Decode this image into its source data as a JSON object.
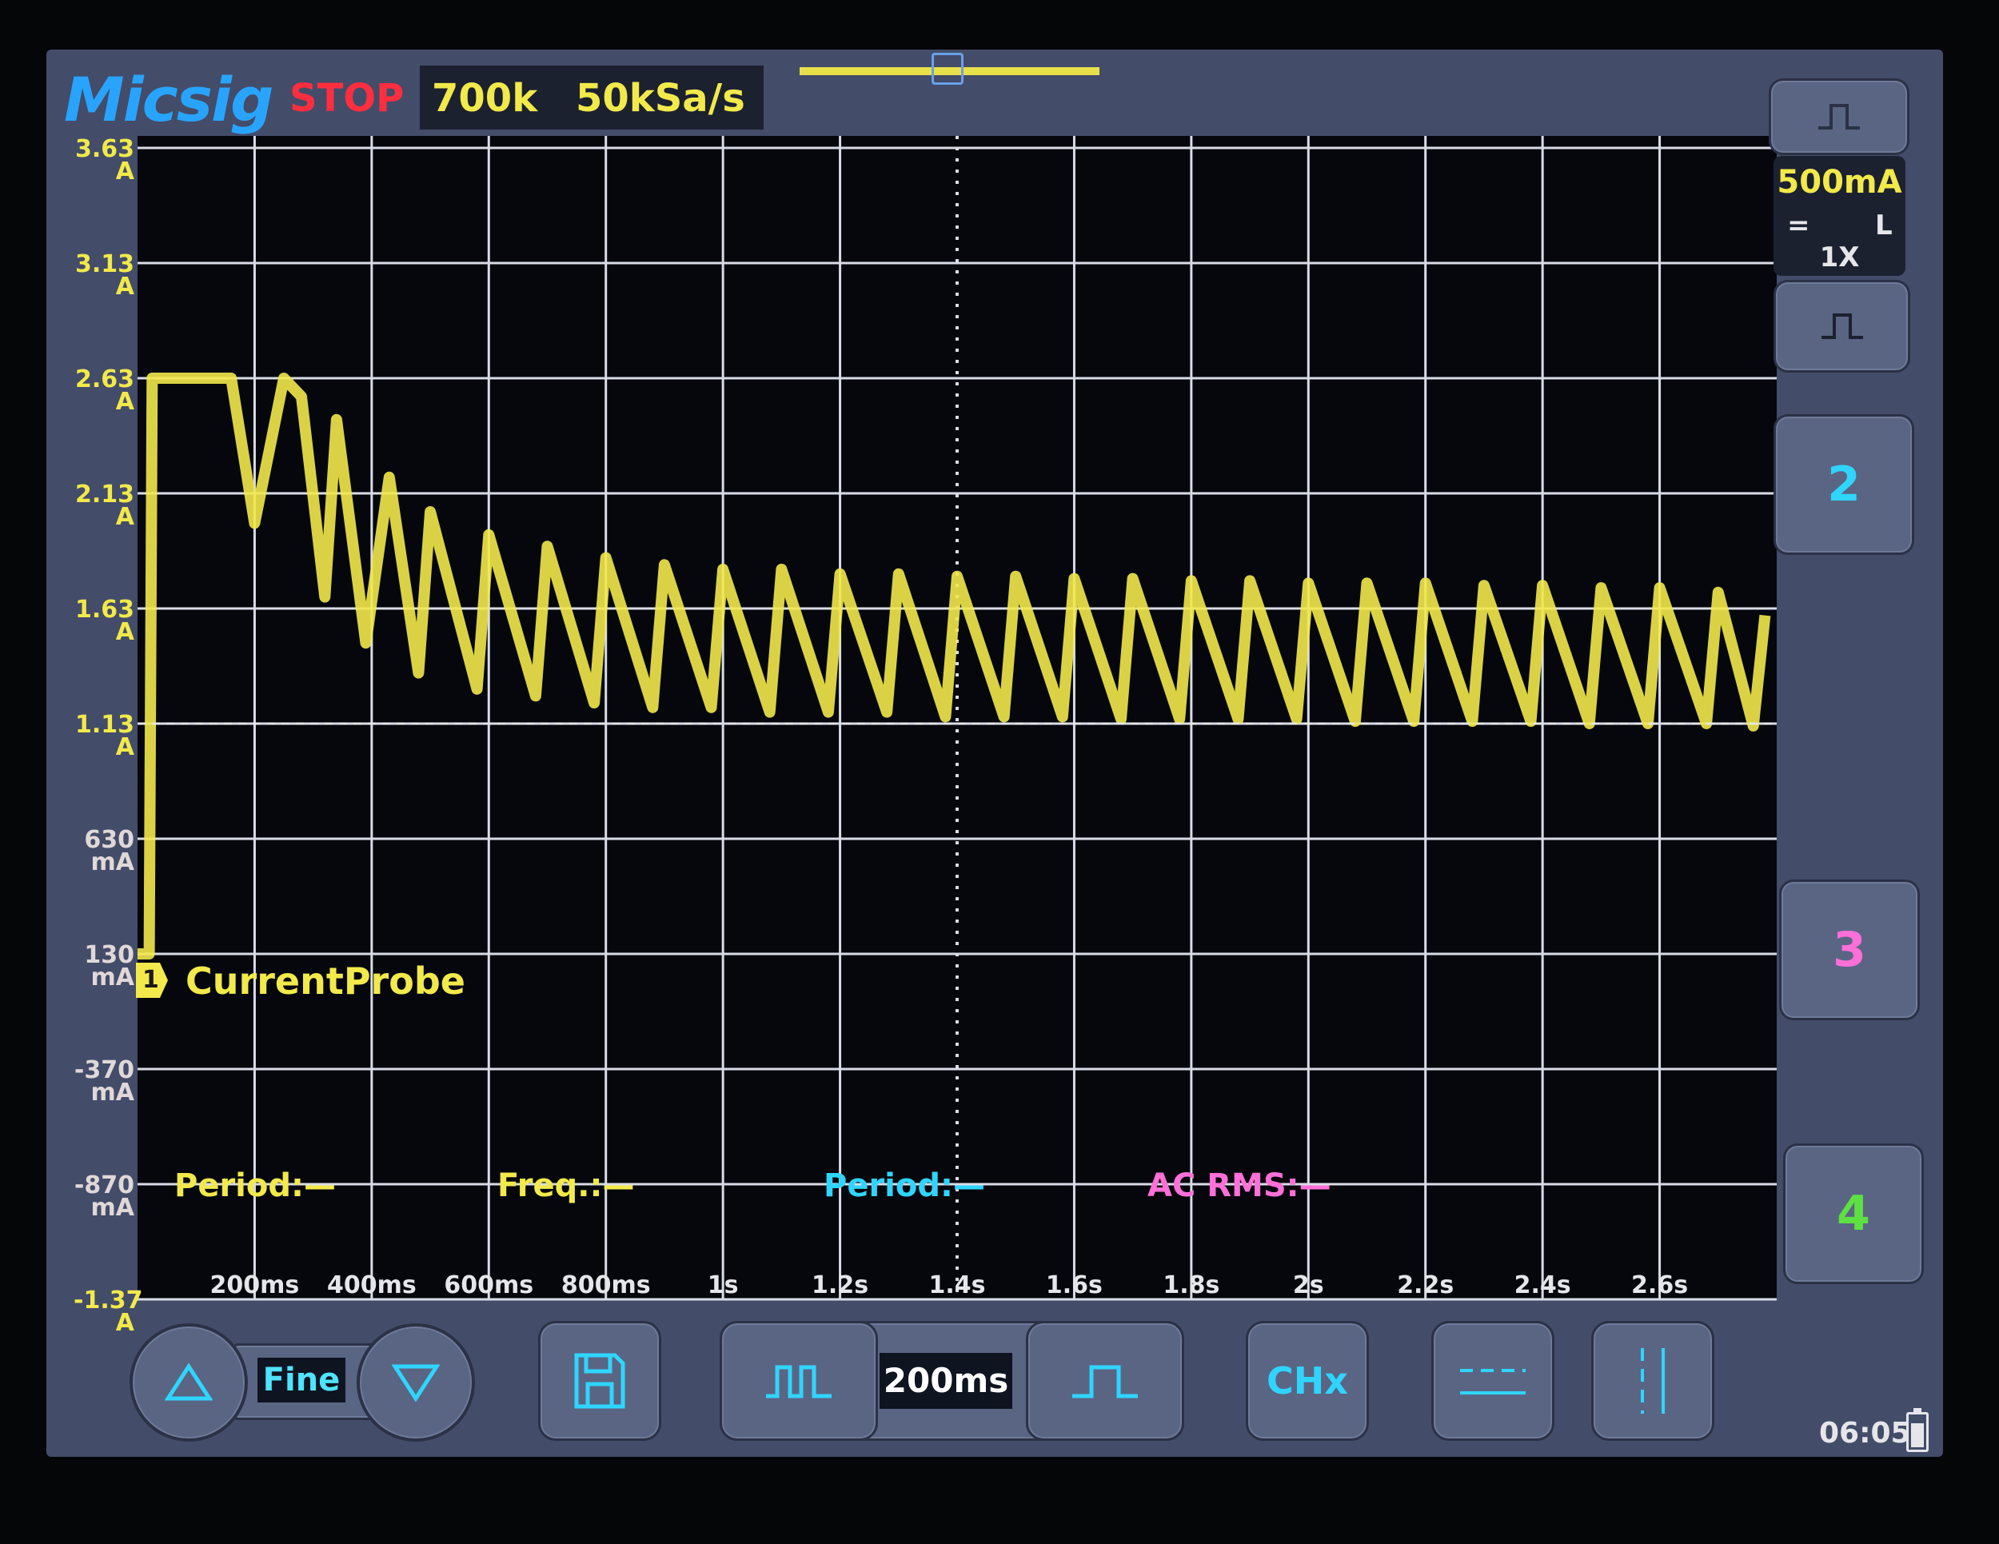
{
  "header": {
    "logo": "Micsig",
    "run_state": "STOP",
    "memory_depth": "700k",
    "sample_rate": "50kSa/s"
  },
  "colors": {
    "ch1": "#f2e94a",
    "ch2": "#2fd5ff",
    "ch3": "#ff6fd8",
    "ch4": "#5ee043",
    "stop": "#ff2e3e",
    "grid": "#d9dce6",
    "screen_bg": "#05070d"
  },
  "screen": {
    "y_labels": [
      {
        "value": "3.63",
        "unit": "A"
      },
      {
        "value": "3.13",
        "unit": "A"
      },
      {
        "value": "2.63",
        "unit": "A"
      },
      {
        "value": "2.13",
        "unit": "A"
      },
      {
        "value": "1.63",
        "unit": "A"
      },
      {
        "value": "1.13",
        "unit": "A"
      },
      {
        "value": "630",
        "unit": "mA"
      },
      {
        "value": "130",
        "unit": "mA"
      },
      {
        "value": "-370",
        "unit": "mA"
      },
      {
        "value": "-870",
        "unit": "mA"
      },
      {
        "value": "-1.37",
        "unit": "A"
      }
    ],
    "x_labels": [
      "200ms",
      "400ms",
      "600ms",
      "800ms",
      "1s",
      "1.2s",
      "1.4s",
      "1.6s",
      "1.8s",
      "2s",
      "2.2s",
      "2.4s",
      "2.6s"
    ],
    "probe_channel": "1",
    "probe_label": "CurrentProbe",
    "measurements": [
      {
        "label": "Period:—",
        "color": "#f2e94a"
      },
      {
        "label": "Freq.:—",
        "color": "#f2e94a"
      },
      {
        "label": "Period:—",
        "color": "#2fd5ff"
      },
      {
        "label": "AC RMS:—",
        "color": "#ff6fd8"
      }
    ]
  },
  "ch1": {
    "scale": "500mA",
    "coupling": "=",
    "bw": "L",
    "probe": "1X"
  },
  "channels": [
    {
      "label": "2",
      "color": "#2fd5ff"
    },
    {
      "label": "3",
      "color": "#ff6fd8"
    },
    {
      "label": "4",
      "color": "#5ee043"
    }
  ],
  "toolbar": {
    "adjust_mode": "Fine",
    "timebase": "200ms",
    "chx_label": "CHx"
  },
  "status": {
    "time": "06:05"
  },
  "icons": [
    "up-arrow-icon",
    "down-arrow-icon",
    "save-icon",
    "zoom-out-pulse-icon",
    "zoom-in-pulse-icon",
    "horizontal-cursor-icon",
    "vertical-cursor-icon",
    "battery-icon",
    "pulse-icon"
  ],
  "chart_data": {
    "type": "line",
    "xlabel": "",
    "ylabel": "",
    "xlim": [
      0,
      2.8
    ],
    "ylim": [
      -1.37,
      3.63
    ],
    "x_unit": "s",
    "y_unit": "A",
    "series": [
      {
        "x": [
          0.0,
          0.02,
          0.025,
          0.16,
          0.2,
          0.25,
          0.28,
          0.32,
          0.34,
          0.39,
          0.43,
          0.48,
          0.5,
          0.58,
          0.6,
          0.68,
          0.7,
          0.78,
          0.8,
          0.88,
          0.9,
          0.98,
          1.0,
          1.08,
          1.1,
          1.18,
          1.2,
          1.28,
          1.3,
          1.38,
          1.4,
          1.48,
          1.5,
          1.58,
          1.6,
          1.68,
          1.7,
          1.78,
          1.8,
          1.88,
          1.9,
          1.98,
          2.0,
          2.08,
          2.1,
          2.18,
          2.2,
          2.28,
          2.3,
          2.38,
          2.4,
          2.48,
          2.5,
          2.58,
          2.6,
          2.68,
          2.7,
          2.76,
          2.78
        ],
        "values": [
          0.13,
          0.13,
          2.63,
          2.63,
          2.0,
          2.63,
          2.55,
          1.68,
          2.45,
          1.48,
          2.2,
          1.35,
          2.05,
          1.28,
          1.95,
          1.25,
          1.9,
          1.22,
          1.85,
          1.2,
          1.82,
          1.2,
          1.8,
          1.18,
          1.8,
          1.18,
          1.78,
          1.18,
          1.78,
          1.16,
          1.77,
          1.16,
          1.77,
          1.16,
          1.76,
          1.15,
          1.76,
          1.15,
          1.75,
          1.15,
          1.75,
          1.15,
          1.74,
          1.14,
          1.74,
          1.14,
          1.74,
          1.14,
          1.73,
          1.14,
          1.73,
          1.13,
          1.72,
          1.13,
          1.72,
          1.13,
          1.7,
          1.12,
          1.6
        ]
      }
    ],
    "trigger_level": 1.13
  }
}
